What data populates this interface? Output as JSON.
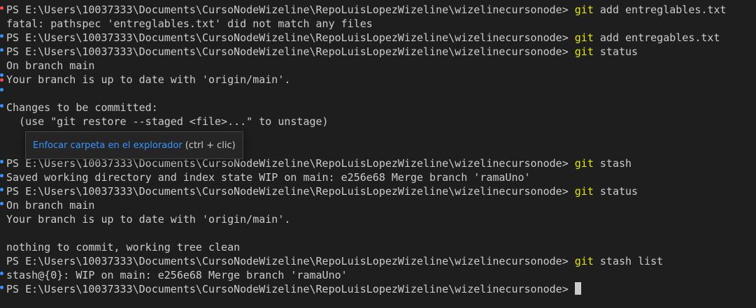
{
  "terminal": {
    "lines": [
      {
        "type": "cmd",
        "prompt": "PS E:\\Users\\10037333\\Documents\\CursoNodeWizeline\\RepoLuisLopezWizeline\\wizelinecursonode> ",
        "git": "git",
        "args": " add entreglables.txt"
      },
      {
        "type": "out",
        "text": "fatal: pathspec 'entreglables.txt' did not match any files"
      },
      {
        "type": "cmd",
        "prompt": "PS E:\\Users\\10037333\\Documents\\CursoNodeWizeline\\RepoLuisLopezWizeline\\wizelinecursonode> ",
        "git": "git",
        "args": " add entregables.txt"
      },
      {
        "type": "cmd",
        "prompt": "PS E:\\Users\\10037333\\Documents\\CursoNodeWizeline\\RepoLuisLopezWizeline\\wizelinecursonode> ",
        "git": "git",
        "args": " status"
      },
      {
        "type": "out",
        "text": "On branch main"
      },
      {
        "type": "out",
        "text": "Your branch is up to date with 'origin/main'."
      },
      {
        "type": "out",
        "text": ""
      },
      {
        "type": "out",
        "text": "Changes to be committed:"
      },
      {
        "type": "out",
        "text": "  (use \"git restore --staged <file>...\" to unstage)"
      },
      {
        "type": "out",
        "text": ""
      },
      {
        "type": "out",
        "text": ""
      },
      {
        "type": "cmd",
        "prompt": "PS E:\\Users\\10037333\\Documents\\CursoNodeWizeline\\RepoLuisLopezWizeline\\wizelinecursonode> ",
        "git": "git",
        "args": " stash"
      },
      {
        "type": "out",
        "text": "Saved working directory and index state WIP on main: e256e68 Merge branch 'ramaUno'"
      },
      {
        "type": "cmd",
        "prompt": "PS E:\\Users\\10037333\\Documents\\CursoNodeWizeline\\RepoLuisLopezWizeline\\wizelinecursonode> ",
        "git": "git",
        "args": " status"
      },
      {
        "type": "out",
        "text": "On branch main"
      },
      {
        "type": "out",
        "text": "Your branch is up to date with 'origin/main'."
      },
      {
        "type": "out",
        "text": ""
      },
      {
        "type": "out",
        "text": "nothing to commit, working tree clean"
      },
      {
        "type": "cmd",
        "prompt": "PS E:\\Users\\10037333\\Documents\\CursoNodeWizeline\\RepoLuisLopezWizeline\\wizelinecursonode> ",
        "git": "git",
        "args": " stash list"
      },
      {
        "type": "out",
        "text": "stash@{0}: WIP on main: e256e68 Merge branch 'ramaUno'"
      },
      {
        "type": "prompt",
        "prompt": "PS E:\\Users\\10037333\\Documents\\CursoNodeWizeline\\RepoLuisLopezWizeline\\wizelinecursonode> "
      }
    ]
  },
  "tooltip": {
    "link_text": "Enfocar carpeta en el explorador",
    "hint_text": "(ctrl + clic)"
  },
  "colors": {
    "background": "#1e1e1e",
    "text": "#cccccc",
    "git_command": "#e5e510",
    "link": "#3794ff",
    "marker_blue": "#3794ff",
    "marker_red": "#f14c4c"
  }
}
